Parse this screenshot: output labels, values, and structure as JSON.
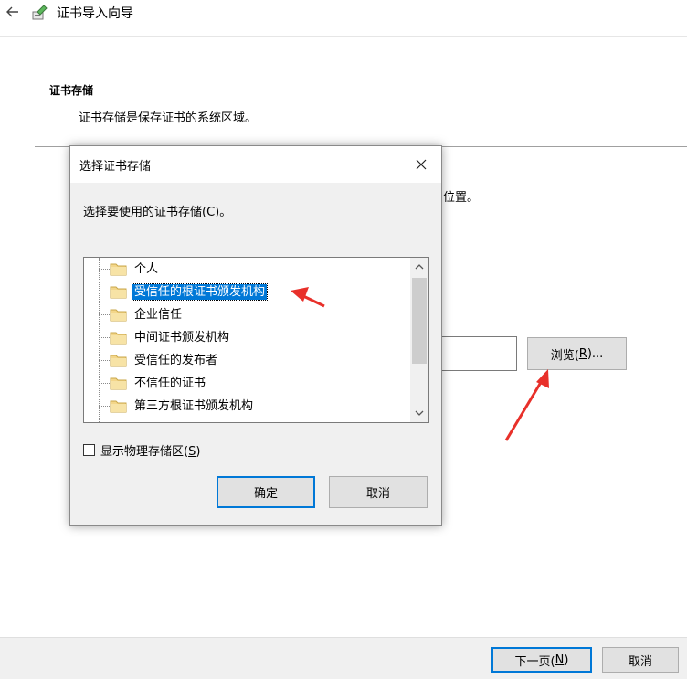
{
  "wizard": {
    "title": "证书导入向导",
    "section_title": "证书存储",
    "section_desc": "证书存储是保存证书的系统区域。",
    "partial_text": "位置。",
    "browse_label": "浏览(",
    "browse_key": "R",
    "browse_suffix": ")...",
    "next_label": "下一页(",
    "next_key": "N",
    "next_suffix": ")",
    "cancel_label": "取消"
  },
  "dialog": {
    "title": "选择证书存储",
    "prompt_prefix": "选择要使用的证书存储(",
    "prompt_key": "C",
    "prompt_suffix": ")。",
    "stores": [
      {
        "label": "个人",
        "selected": false
      },
      {
        "label": "受信任的根证书颁发机构",
        "selected": true
      },
      {
        "label": "企业信任",
        "selected": false
      },
      {
        "label": "中间证书颁发机构",
        "selected": false
      },
      {
        "label": "受信任的发布者",
        "selected": false
      },
      {
        "label": "不信任的证书",
        "selected": false
      },
      {
        "label": "第三方根证书颁发机构",
        "selected": false
      }
    ],
    "show_physical_prefix": "显示物理存储区(",
    "show_physical_key": "S",
    "show_physical_suffix": ")",
    "show_physical_checked": false,
    "ok_label": "确定",
    "cancel_label": "取消"
  },
  "colors": {
    "accent": "#0078d7",
    "annotation_arrow": "#e8302a",
    "folder_fill": "#f3d68a"
  }
}
